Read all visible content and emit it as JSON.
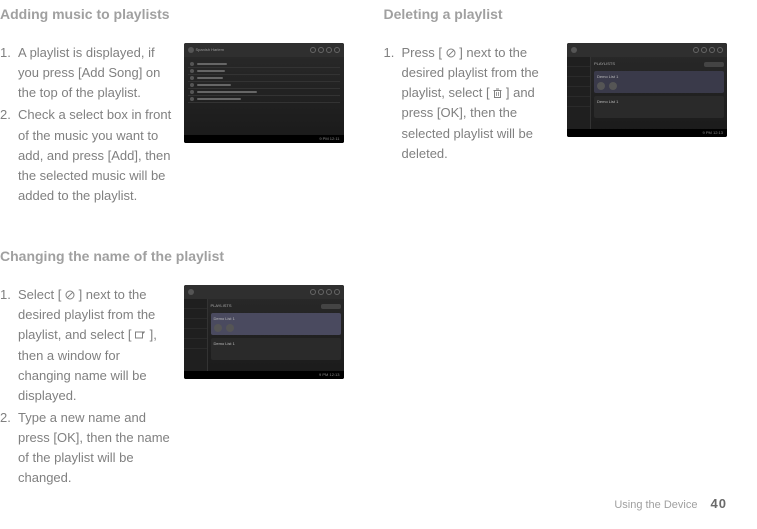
{
  "sections": {
    "adding": {
      "heading": "Adding music to playlists",
      "items": [
        "A playlist is displayed, if you press [Add Song] on the top of the playlist.",
        "Check a select box in front of the music you want to add, and press [Add], then the selected music will be added to the playlist."
      ],
      "shot_lines": [
        "Angel Of Harlem",
        "In A Mellow Tone",
        "Spanish Harlem",
        "Storms Are On the Ocean",
        "Tchaikovsky: Waltz of the Flowers from The Nutcracker Suite"
      ],
      "shot_title": "Spanish Harlem",
      "shot_time": "9 PM  12:11"
    },
    "deleting": {
      "heading": "Deleting a playlist",
      "step_pre": "Press [ ",
      "step_mid1": " ] next to the desired playlist from the playlist, select [ ",
      "step_mid2": " ] and press [OK], then the selected playlist will be deleted.",
      "shot_hdr": "PLAYLISTS",
      "shot_card1": "Demo List 1",
      "shot_card2": "Demo List 1",
      "shot_time": "9 PM  12:13"
    },
    "changing": {
      "heading": "Changing the name of the playlist",
      "step1_pre": "Select [ ",
      "step1_mid1": " ] next to the desired playlist from the playlist, and select [ ",
      "step1_mid2": " ], then a window for changing name will be displayed.",
      "step2": "Type a new name and press [OK], then the name of the playlist will be changed.",
      "shot_hdr": "PLAYLISTS",
      "shot_card1": "Demo List 1",
      "shot_card2": "Demo List 1",
      "shot_time": "9 PM  12:13"
    }
  },
  "footer": {
    "label": "Using the Device",
    "page": "40"
  }
}
